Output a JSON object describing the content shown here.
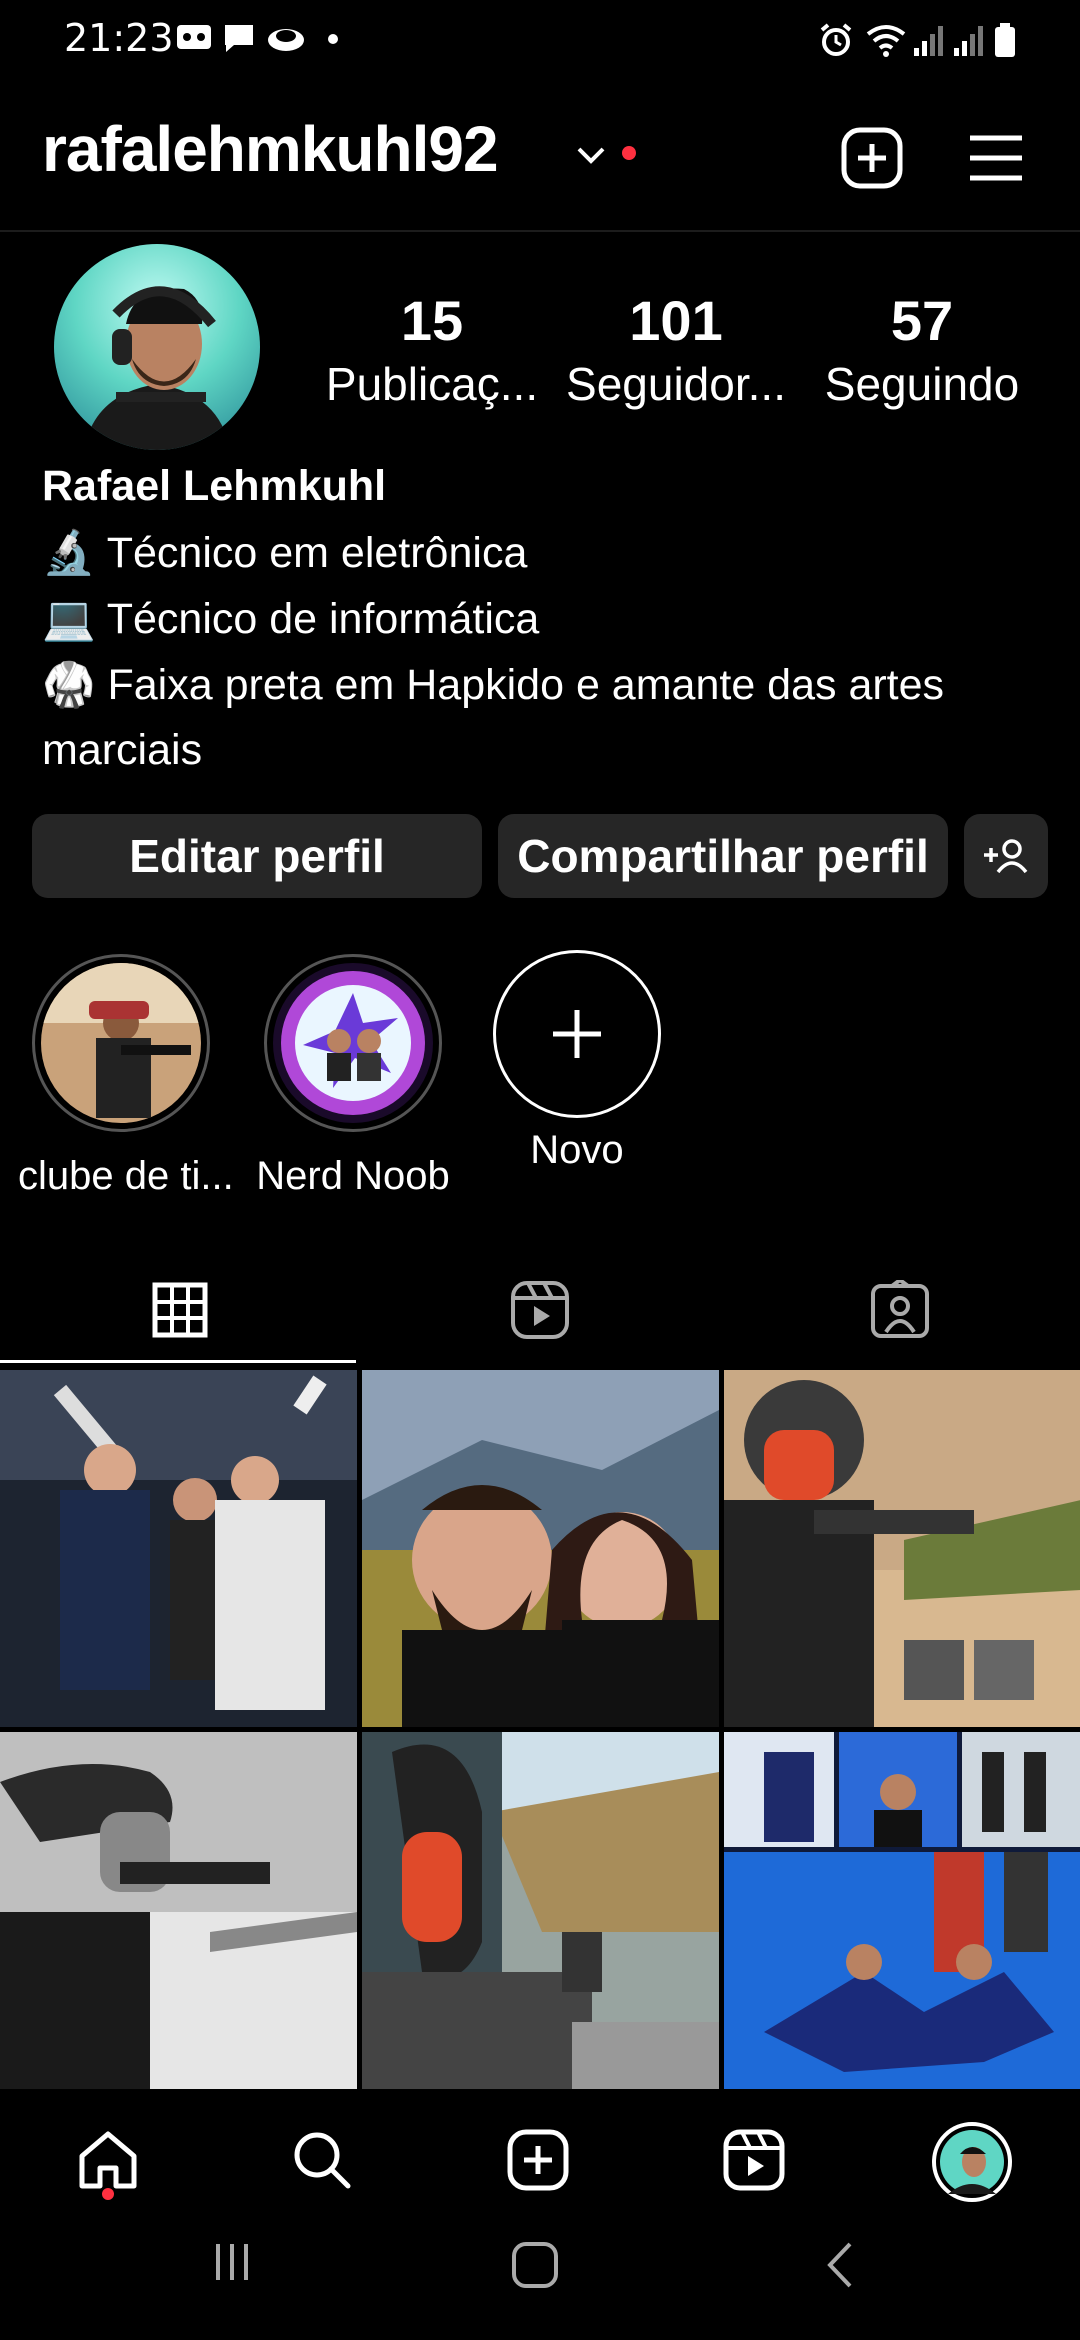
{
  "status_bar": {
    "time": "21:23"
  },
  "header": {
    "username": "rafalehmkuhl92"
  },
  "profile": {
    "stats": [
      {
        "value": "15",
        "label": "Publicaç..."
      },
      {
        "value": "101",
        "label": "Seguidor..."
      },
      {
        "value": "57",
        "label": "Seguindo"
      }
    ],
    "name": "Rafael Lehmkuhl",
    "bio": [
      {
        "emoji": "🔬",
        "text": "Técnico em eletrônica"
      },
      {
        "emoji": "💻",
        "text": "Técnico de informática"
      },
      {
        "emoji": "🥋",
        "text": "Faixa preta em Hapkido e amante das artes"
      }
    ],
    "bio_cont": "marciais"
  },
  "buttons": {
    "edit": "Editar perfil",
    "share": "Compartilhar perfil"
  },
  "highlights": [
    {
      "label": "clube de ti..."
    },
    {
      "label": "Nerd Noob"
    },
    {
      "label": "Novo"
    }
  ],
  "colors": {
    "notification_dot": "#ff3040",
    "button_bg": "#262626",
    "background": "#000000"
  }
}
